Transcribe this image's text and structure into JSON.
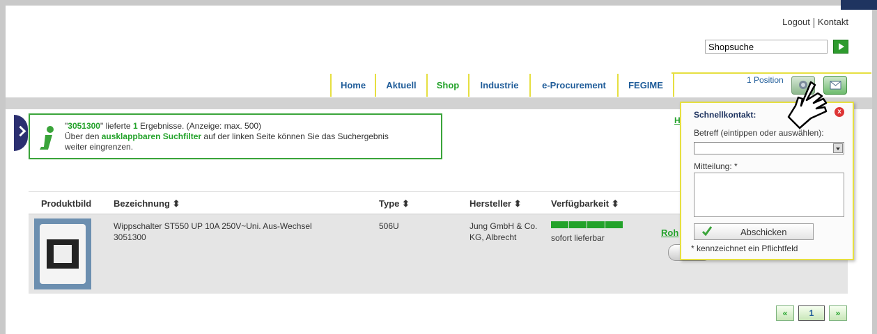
{
  "header": {
    "logout": "Logout",
    "contact": "Kontakt",
    "search_placeholder": "Shopsuche",
    "search_value": "Shopsuche"
  },
  "nav": {
    "tabs": [
      {
        "label": "Home"
      },
      {
        "label": "Aktuell"
      },
      {
        "label": "Shop"
      },
      {
        "label": "Industrie"
      },
      {
        "label": "e-Procurement"
      },
      {
        "label": "FEGIME"
      }
    ],
    "active": "Shop",
    "position": "1 Position"
  },
  "info": {
    "query": "3051300",
    "count": "1",
    "line1_pre": "\"",
    "line1_mid": "\" lieferte ",
    "line1_post": " Ergebnisse. (Anzeige: max. 500)",
    "line2_pre": "Über den ",
    "line2_link": "ausklappbaren Suchfilter",
    "line2_post": " auf der linken Seite können Sie das Suchergebnis",
    "line3": "weiter eingrenzen."
  },
  "side_link": "H",
  "table": {
    "headers": {
      "image": "Produktbild",
      "name": "Bezeichnung ⬍",
      "type": "Type ⬍",
      "manufacturer": "Hersteller ⬍",
      "availability": "Verfügbarkeit ⬍"
    },
    "rows": [
      {
        "name": "Wippschalter ST550 UP 10A 250V~Uni. Aus-Wechsel",
        "article": "3051300",
        "type": "506U",
        "manufacturer_line1": "Jung GmbH & Co.",
        "manufacturer_line2": "KG, Albrecht",
        "availability_text": "sofort lieferbar",
        "availability_level": 5,
        "link": "Roh"
      }
    ]
  },
  "pager": {
    "prev": "«",
    "current": "1",
    "next": "»"
  },
  "quick_contact": {
    "title": "Schnellkontakt:",
    "close": "x",
    "subject_label": "Betreff (eintippen oder auswählen):",
    "message_label": "Mitteilung: *",
    "submit": "Abschicken",
    "note": "* kennzeichnet ein Pflichtfeld"
  },
  "colors": {
    "green": "#23a22a",
    "blue": "#1f5c99",
    "yellow": "#e6df40",
    "navy": "#1f3460"
  },
  "icons": [
    "chevron-right-icon",
    "info-icon",
    "search-go-icon",
    "cart-icon",
    "contact-icon",
    "close-icon",
    "checkmark-icon",
    "hand-cursor-icon",
    "sort-icon"
  ]
}
